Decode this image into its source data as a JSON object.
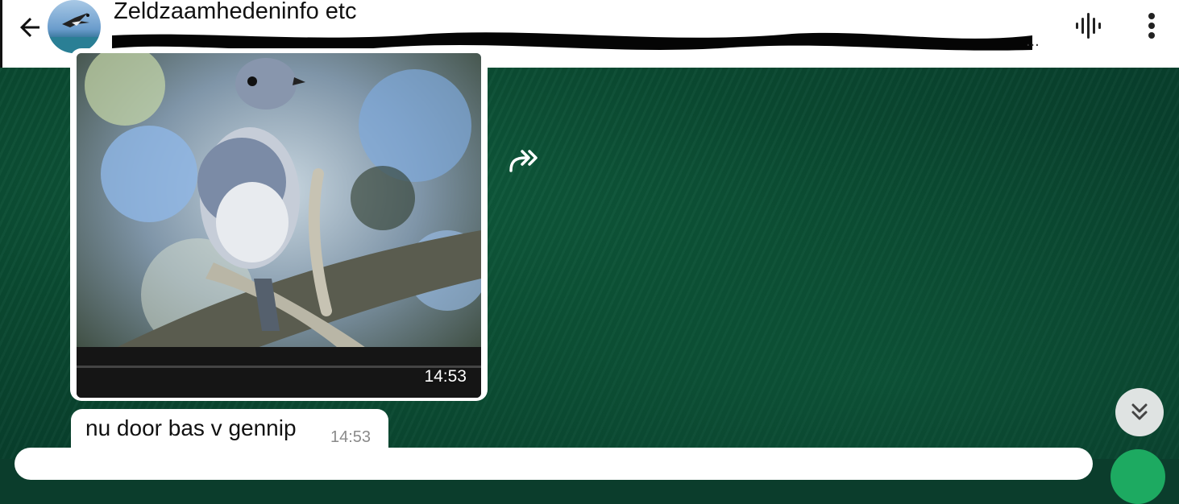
{
  "header": {
    "title": "Zeldzaamhedeninfo etc",
    "subtitle": "...",
    "icons": {
      "back": "back-arrow-icon",
      "avatar": "group-avatar",
      "audio": "voice-chat-icon",
      "more": "more-vert-icon"
    }
  },
  "messages": [
    {
      "type": "image",
      "time": "14:53"
    },
    {
      "type": "text",
      "text": "nu door bas v gennip",
      "time": "14:53"
    }
  ],
  "controls": {
    "forward_icon": "forward-icon",
    "scroll_down_icon": "double-chevron-down-icon"
  },
  "colors": {
    "header_bg": "#ffffff",
    "wallpaper": "#0b3d2c",
    "bubble_bg": "#ffffff",
    "send_button": "#1daa61"
  }
}
